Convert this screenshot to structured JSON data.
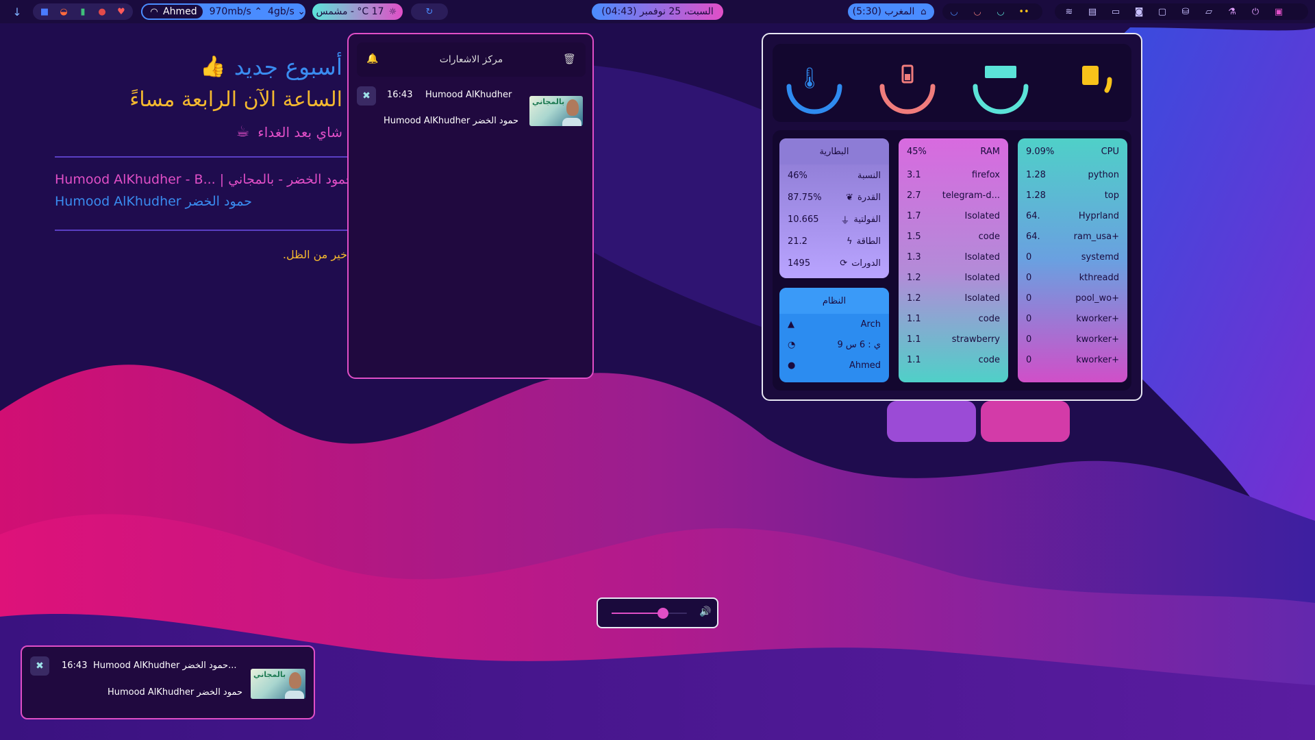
{
  "topbar": {
    "network_user": "Ahmed",
    "upload": "970mb/s",
    "download": "4gb/s",
    "weather": "17 C° - مشمس",
    "datetime": "(04:43) السبت، 25 نوفمبر",
    "prayer": "المغرب (5:30)"
  },
  "desktop": {
    "headline": "أسبوع جديد",
    "subheadline": "الساعة الآن الرابعة مساءً",
    "reminder": "شاي بعد الغداء",
    "media_title": "Humood AlKhudher - B... | حمود الخضر - بالمجاني",
    "media_artist": "Humood AlKhudher حمود الخضر",
    "quote": "خير من الظل."
  },
  "notification_center": {
    "title": "مركز الاشعارات",
    "notifications": [
      {
        "time": "16:43",
        "title": "Humood AlKhudher حمود الخضر",
        "body": "Humood AlKhudher حمود الخضر",
        "thumb_text": "بالمجاني"
      }
    ]
  },
  "system": {
    "gauges": [
      {
        "name": "temperature",
        "color": "#2f8bf0",
        "level": 0.55
      },
      {
        "name": "battery",
        "color": "#f07c7c",
        "level": 0.46
      },
      {
        "name": "ram",
        "color": "#5be3d8",
        "level": 0.45
      },
      {
        "name": "cpu",
        "color": "#f8c21a",
        "level": 0.09
      }
    ],
    "battery": {
      "title": "البطارية",
      "rows": [
        {
          "label": "النسبة",
          "value": "46%",
          "icon": ""
        },
        {
          "label": "القدرة",
          "value": "87.75%",
          "icon": "leaf-icon"
        },
        {
          "label": "الفولتية",
          "value": "10.665",
          "icon": "plug-icon"
        },
        {
          "label": "الطاقة",
          "value": "21.2",
          "icon": "bolt-icon"
        },
        {
          "label": "الدورات",
          "value": "1495",
          "icon": "cycle-icon"
        }
      ]
    },
    "system_info": {
      "title": "النظام",
      "rows": [
        {
          "label": "Arch",
          "icon": "arch-icon"
        },
        {
          "label": "9 ي : 6 س",
          "icon": "uptime-icon"
        },
        {
          "label": "Ahmed",
          "icon": "user-icon"
        }
      ]
    },
    "ram": {
      "title": "RAM",
      "percent": "45%",
      "processes": [
        {
          "name": "firefox",
          "value": "3.1"
        },
        {
          "name": "telegram-d...",
          "value": "2.7"
        },
        {
          "name": "Isolated",
          "value": "1.7"
        },
        {
          "name": "code",
          "value": "1.5"
        },
        {
          "name": "Isolated",
          "value": "1.3"
        },
        {
          "name": "Isolated",
          "value": "1.2"
        },
        {
          "name": "Isolated",
          "value": "1.2"
        },
        {
          "name": "code",
          "value": "1.1"
        },
        {
          "name": "strawberry",
          "value": "1.1"
        },
        {
          "name": "code",
          "value": "1.1"
        }
      ]
    },
    "cpu": {
      "title": "CPU",
      "percent": "9.09%",
      "processes": [
        {
          "name": "python",
          "value": "1.28"
        },
        {
          "name": "top",
          "value": "1.28"
        },
        {
          "name": "Hyprland",
          "value": "64."
        },
        {
          "name": "ram_usa+",
          "value": "64."
        },
        {
          "name": "systemd",
          "value": "0"
        },
        {
          "name": "kthreadd",
          "value": "0"
        },
        {
          "name": "pool_wo+",
          "value": "0"
        },
        {
          "name": "kworker+",
          "value": "0"
        },
        {
          "name": "kworker+",
          "value": "0"
        },
        {
          "name": "kworker+",
          "value": "0"
        }
      ]
    }
  },
  "volume": {
    "level": 0.68
  },
  "toast": {
    "time": "16:43",
    "title": "Humood AlKhudher حمود الخضر...",
    "body": "Humood AlKhudher حمود الخضر",
    "thumb_text": "بالمجاني"
  }
}
